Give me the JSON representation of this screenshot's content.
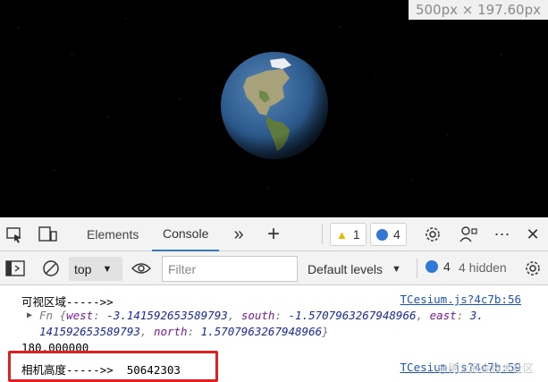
{
  "viewport": {
    "dimensions_label": "500px × 197.60px"
  },
  "devtools": {
    "tabs": [
      {
        "label": "Elements",
        "active": false
      },
      {
        "label": "Console",
        "active": true
      }
    ],
    "warnings_count": "1",
    "messages_count": "4"
  },
  "console_toolbar": {
    "context": "top",
    "filter_placeholder": "Filter",
    "levels_label": "Default levels",
    "messages_count": "4",
    "hidden_label": "4 hidden"
  },
  "log": {
    "line1_text": "可视区域----->>",
    "line1_source": "TCesium.js?4c7b:56",
    "obj_prefix": "Fn {",
    "west_key": "west",
    "west_val": "-3.141592653589793",
    "south_key": "south",
    "south_val": "-1.5707963267948966",
    "east_key": "east",
    "east_val_part1": "3.",
    "east_val_part2": "141592653589793",
    "north_key": "north",
    "north_val": "1.5707963267948966",
    "line3_text": "180.000000",
    "line4_text": "相机高度----->>  50642303",
    "line4_source": "TCesium.js?4c7b:59",
    "watermark": "@稀土掘金技术社区"
  },
  "colors": {
    "accent": "#2f78d6",
    "link": "#1a55b0",
    "warning": "#f0b400",
    "highlight_border": "#e02020"
  }
}
